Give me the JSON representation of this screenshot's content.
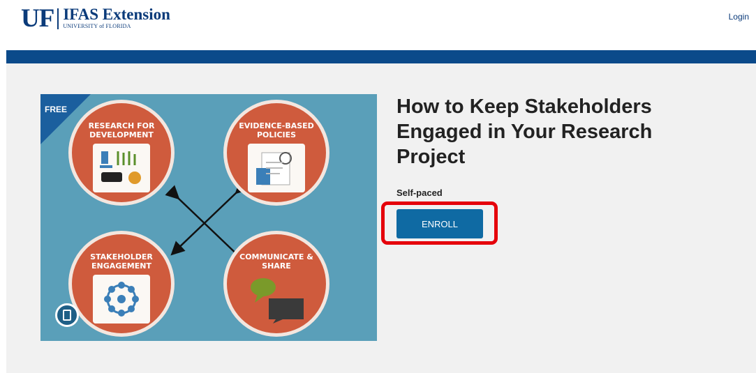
{
  "header": {
    "logo_uf": "UF",
    "logo_main": "IFAS Extension",
    "logo_sub": "UNIVERSITY of FLORIDA",
    "login_label": "Login"
  },
  "course": {
    "badge": "FREE",
    "title": "How to Keep Stakeholders Engaged in Your Research Project",
    "pace": "Self-paced",
    "enroll_label": "ENROLL",
    "image_labels": {
      "tl": "RESEARCH FOR DEVELOPMENT",
      "tr": "EVIDENCE-BASED POLICIES",
      "bl": "STAKEHOLDER ENGAGEMENT",
      "br": "COMMUNICATE & SHARE"
    }
  },
  "colors": {
    "brand_blue": "#0b4a8a",
    "button_blue": "#0f6aa3",
    "highlight_red": "#e5000b",
    "circle_orange": "#cf5b3d",
    "image_bg": "#5a9fb9"
  }
}
